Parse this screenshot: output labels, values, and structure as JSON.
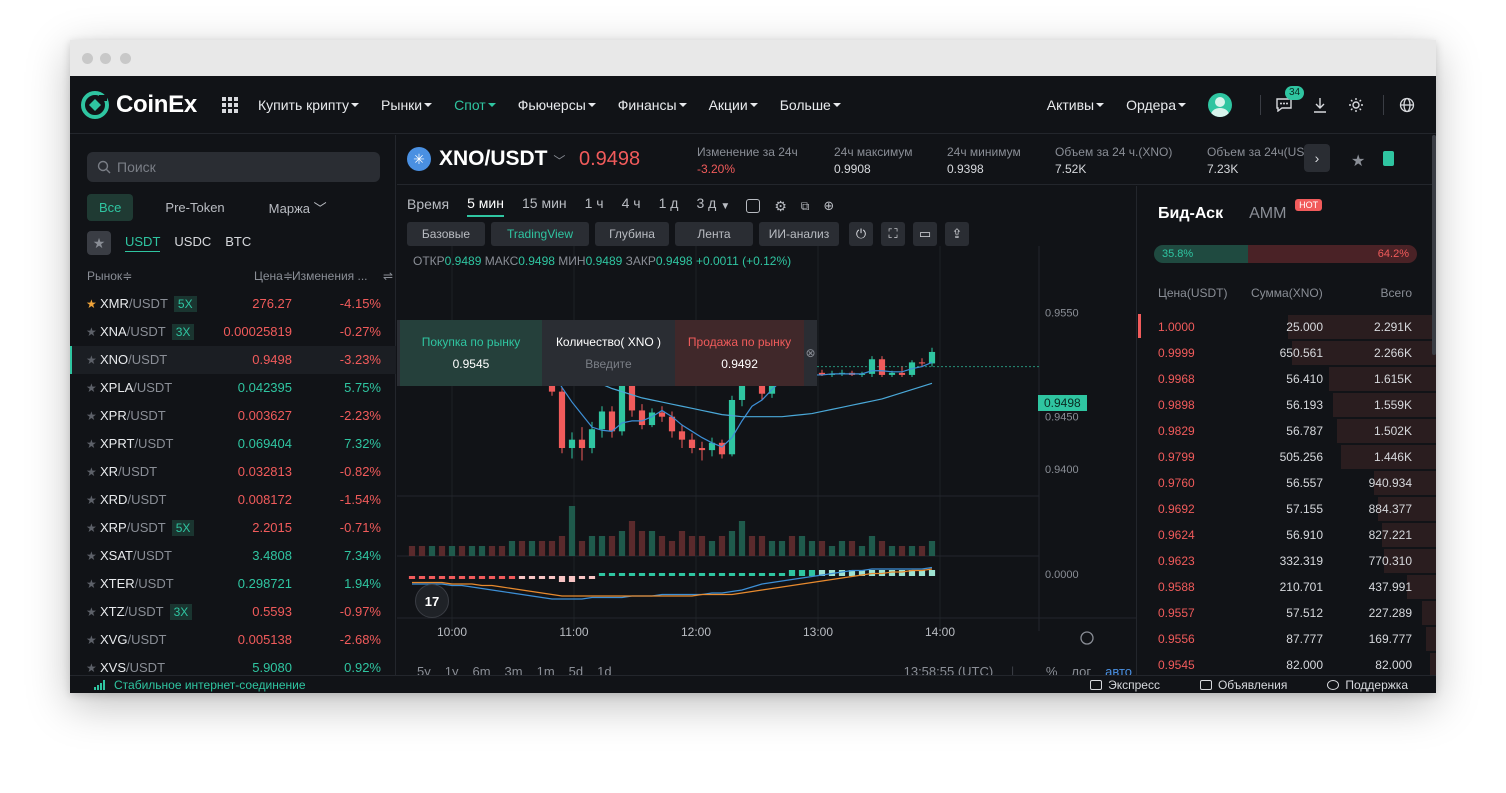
{
  "nav": {
    "logo": "CoinEx",
    "items": [
      {
        "label": "Купить крипту",
        "active": false
      },
      {
        "label": "Рынки",
        "active": false
      },
      {
        "label": "Спот",
        "active": true
      },
      {
        "label": "Фьючерсы",
        "active": false
      },
      {
        "label": "Финансы",
        "active": false
      },
      {
        "label": "Акции",
        "active": false
      },
      {
        "label": "Больше",
        "active": false
      }
    ],
    "right": {
      "assets": "Активы",
      "orders": "Ордера",
      "notifications_count": "34",
      "icons": [
        "chat-icon",
        "download-icon",
        "theme-icon",
        "globe-icon"
      ]
    }
  },
  "sidebar": {
    "search_placeholder": "Поиск",
    "filters": [
      "Все",
      "Pre-Token",
      "Маржа"
    ],
    "active_filter": "Все",
    "quote_tabs": [
      "USDT",
      "USDC",
      "BTC"
    ],
    "active_quote": "USDT",
    "col_market": "Рынок",
    "col_price": "Цена",
    "col_change": "Изменения ...",
    "pairs": [
      {
        "base": "XMR",
        "quote": "/USDT",
        "lev": "5X",
        "price": "276.27",
        "change": "-4.15%",
        "dir": "down",
        "fav": true
      },
      {
        "base": "XNA",
        "quote": "/USDT",
        "lev": "3X",
        "price": "0.00025819",
        "change": "-0.27%",
        "dir": "down",
        "fav": false
      },
      {
        "base": "XNO",
        "quote": "/USDT",
        "lev": "",
        "price": "0.9498",
        "change": "-3.23%",
        "dir": "down",
        "fav": false,
        "selected": true
      },
      {
        "base": "XPLA",
        "quote": "/USDT",
        "lev": "",
        "price": "0.042395",
        "change": "5.75%",
        "dir": "up",
        "fav": false
      },
      {
        "base": "XPR",
        "quote": "/USDT",
        "lev": "",
        "price": "0.003627",
        "change": "-2.23%",
        "dir": "down",
        "fav": false
      },
      {
        "base": "XPRT",
        "quote": "/USDT",
        "lev": "",
        "price": "0.069404",
        "change": "7.32%",
        "dir": "up",
        "fav": false
      },
      {
        "base": "XR",
        "quote": "/USDT",
        "lev": "",
        "price": "0.032813",
        "change": "-0.82%",
        "dir": "down",
        "fav": false
      },
      {
        "base": "XRD",
        "quote": "/USDT",
        "lev": "",
        "price": "0.008172",
        "change": "-1.54%",
        "dir": "down",
        "fav": false
      },
      {
        "base": "XRP",
        "quote": "/USDT",
        "lev": "5X",
        "price": "2.2015",
        "change": "-0.71%",
        "dir": "down",
        "fav": false
      },
      {
        "base": "XSAT",
        "quote": "/USDT",
        "lev": "",
        "price": "3.4808",
        "change": "7.34%",
        "dir": "up",
        "fav": false
      },
      {
        "base": "XTER",
        "quote": "/USDT",
        "lev": "",
        "price": "0.298721",
        "change": "1.94%",
        "dir": "up",
        "fav": false
      },
      {
        "base": "XTZ",
        "quote": "/USDT",
        "lev": "3X",
        "price": "0.5593",
        "change": "-0.97%",
        "dir": "down",
        "fav": false
      },
      {
        "base": "XVG",
        "quote": "/USDT",
        "lev": "",
        "price": "0.005138",
        "change": "-2.68%",
        "dir": "down",
        "fav": false
      },
      {
        "base": "XVS",
        "quote": "/USDT",
        "lev": "",
        "price": "5.9080",
        "change": "0.92%",
        "dir": "up",
        "fav": false
      }
    ]
  },
  "ticker": {
    "symbol": "XNO/USDT",
    "last_price": "0.9498",
    "stats": [
      {
        "label": "Изменение за 24ч",
        "value": "-3.20%",
        "dir": "down"
      },
      {
        "label": "24ч максимум",
        "value": "0.9908",
        "dir": "neutral"
      },
      {
        "label": "24ч минимум",
        "value": "0.9398",
        "dir": "neutral"
      },
      {
        "label": "Объем за 24 ч.(XNO)",
        "value": "7.52K",
        "dir": "neutral"
      },
      {
        "label": "Объем за 24ч(USDT)",
        "value": "7.23K",
        "dir": "neutral"
      }
    ]
  },
  "chart": {
    "timeframe_label": "Время",
    "timeframes": [
      "5 мин",
      "15 мин",
      "1 ч",
      "4 ч",
      "1 д",
      "3 д"
    ],
    "active_timeframe": "5 мин",
    "views": [
      "Базовые",
      "TradingView",
      "Глубина",
      "Лента",
      "ИИ-анализ"
    ],
    "active_view": "TradingView",
    "ohlc": {
      "open_label": "ОТКР",
      "open": "0.9489",
      "high_label": "МАКС",
      "high": "0.9498",
      "low_label": "МИН",
      "low": "0.9489",
      "close_label": "ЗАКР",
      "close": "0.9498",
      "change": "+0.0011 (+0.12%)"
    },
    "quick_trade": {
      "buy_label": "Покупка по рынку",
      "buy_price": "0.9545",
      "qty_label": "Количество( XNO )",
      "qty_placeholder": "Введите",
      "sell_label": "Продажа по рынку",
      "sell_price": "0.9492"
    },
    "price_tag": "0.9498",
    "tv_logo": "17",
    "footer_ranges": [
      "5y",
      "1y",
      "6m",
      "3m",
      "1m",
      "5d",
      "1d"
    ],
    "footer_time": "13:58:55 (UTC)",
    "footer_right": [
      "%",
      "лог",
      "авто"
    ],
    "colors": {
      "up": "#2fc5a1",
      "down": "#f15b5b",
      "ma1": "#3d8fd6",
      "ma2": "#4aa8d8",
      "macd": "#e88a2e"
    }
  },
  "chart_data": {
    "type": "candlestick",
    "symbol": "XNO/USDT",
    "interval": "5 мин",
    "y_ticks": [
      "0.9550",
      "0.9450",
      "0.9400"
    ],
    "indicator_tick": "0.0000",
    "x_ticks": [
      "10:00",
      "11:00",
      "12:00",
      "13:00",
      "14:00"
    ],
    "candles": [
      {
        "o": 0.952,
        "h": 0.9528,
        "l": 0.9505,
        "c": 0.9512
      },
      {
        "o": 0.9512,
        "h": 0.9519,
        "l": 0.9502,
        "c": 0.9507
      },
      {
        "o": 0.9507,
        "h": 0.9523,
        "l": 0.95,
        "c": 0.9516
      },
      {
        "o": 0.9516,
        "h": 0.952,
        "l": 0.949,
        "c": 0.9495
      },
      {
        "o": 0.9495,
        "h": 0.9522,
        "l": 0.949,
        "c": 0.9518
      },
      {
        "o": 0.9518,
        "h": 0.9524,
        "l": 0.9508,
        "c": 0.9512
      },
      {
        "o": 0.9512,
        "h": 0.9518,
        "l": 0.9505,
        "c": 0.9515
      },
      {
        "o": 0.9515,
        "h": 0.953,
        "l": 0.951,
        "c": 0.9526
      },
      {
        "o": 0.9526,
        "h": 0.9532,
        "l": 0.9508,
        "c": 0.9512
      },
      {
        "o": 0.9512,
        "h": 0.9516,
        "l": 0.9505,
        "c": 0.9508
      },
      {
        "o": 0.9508,
        "h": 0.9511,
        "l": 0.9505,
        "c": 0.9508
      },
      {
        "o": 0.9508,
        "h": 0.9512,
        "l": 0.9492,
        "c": 0.9496
      },
      {
        "o": 0.9496,
        "h": 0.9502,
        "l": 0.949,
        "c": 0.95
      },
      {
        "o": 0.95,
        "h": 0.9505,
        "l": 0.9494,
        "c": 0.9496
      },
      {
        "o": 0.9496,
        "h": 0.95,
        "l": 0.947,
        "c": 0.9474
      },
      {
        "o": 0.9474,
        "h": 0.9478,
        "l": 0.9415,
        "c": 0.942
      },
      {
        "o": 0.942,
        "h": 0.9435,
        "l": 0.941,
        "c": 0.9428
      },
      {
        "o": 0.9428,
        "h": 0.944,
        "l": 0.9408,
        "c": 0.942
      },
      {
        "o": 0.942,
        "h": 0.9445,
        "l": 0.9415,
        "c": 0.9438
      },
      {
        "o": 0.9438,
        "h": 0.946,
        "l": 0.943,
        "c": 0.9455
      },
      {
        "o": 0.9455,
        "h": 0.946,
        "l": 0.943,
        "c": 0.9436
      },
      {
        "o": 0.9436,
        "h": 0.9488,
        "l": 0.9432,
        "c": 0.9484
      },
      {
        "o": 0.9484,
        "h": 0.949,
        "l": 0.945,
        "c": 0.9456
      },
      {
        "o": 0.9456,
        "h": 0.9462,
        "l": 0.9438,
        "c": 0.9442
      },
      {
        "o": 0.9442,
        "h": 0.9458,
        "l": 0.944,
        "c": 0.9454
      },
      {
        "o": 0.9454,
        "h": 0.946,
        "l": 0.9445,
        "c": 0.945
      },
      {
        "o": 0.945,
        "h": 0.9455,
        "l": 0.943,
        "c": 0.9436
      },
      {
        "o": 0.9436,
        "h": 0.9442,
        "l": 0.942,
        "c": 0.9428
      },
      {
        "o": 0.9428,
        "h": 0.9434,
        "l": 0.9415,
        "c": 0.942
      },
      {
        "o": 0.942,
        "h": 0.9426,
        "l": 0.9408,
        "c": 0.9418
      },
      {
        "o": 0.9418,
        "h": 0.943,
        "l": 0.9412,
        "c": 0.9425
      },
      {
        "o": 0.9425,
        "h": 0.9428,
        "l": 0.941,
        "c": 0.9414
      },
      {
        "o": 0.9414,
        "h": 0.947,
        "l": 0.9412,
        "c": 0.9466
      },
      {
        "o": 0.9466,
        "h": 0.95,
        "l": 0.946,
        "c": 0.9496
      },
      {
        "o": 0.9496,
        "h": 0.9504,
        "l": 0.9482,
        "c": 0.9488
      },
      {
        "o": 0.9488,
        "h": 0.9492,
        "l": 0.9466,
        "c": 0.9472
      },
      {
        "o": 0.9472,
        "h": 0.9494,
        "l": 0.9468,
        "c": 0.949
      },
      {
        "o": 0.949,
        "h": 0.9502,
        "l": 0.9486,
        "c": 0.9498
      },
      {
        "o": 0.9498,
        "h": 0.95,
        "l": 0.9488,
        "c": 0.949
      },
      {
        "o": 0.949,
        "h": 0.9493,
        "l": 0.9487,
        "c": 0.9491
      },
      {
        "o": 0.9491,
        "h": 0.9494,
        "l": 0.9488,
        "c": 0.9492
      },
      {
        "o": 0.9492,
        "h": 0.9495,
        "l": 0.9489,
        "c": 0.949
      },
      {
        "o": 0.949,
        "h": 0.9494,
        "l": 0.9488,
        "c": 0.9491
      },
      {
        "o": 0.9491,
        "h": 0.9495,
        "l": 0.9489,
        "c": 0.9492
      },
      {
        "o": 0.9492,
        "h": 0.9494,
        "l": 0.9489,
        "c": 0.949
      },
      {
        "o": 0.949,
        "h": 0.9493,
        "l": 0.9488,
        "c": 0.9491
      },
      {
        "o": 0.9491,
        "h": 0.9508,
        "l": 0.9488,
        "c": 0.9505
      },
      {
        "o": 0.9505,
        "h": 0.9508,
        "l": 0.9488,
        "c": 0.949
      },
      {
        "o": 0.949,
        "h": 0.9494,
        "l": 0.9488,
        "c": 0.9492
      },
      {
        "o": 0.9492,
        "h": 0.9498,
        "l": 0.9488,
        "c": 0.949
      },
      {
        "o": 0.949,
        "h": 0.9504,
        "l": 0.9488,
        "c": 0.9502
      },
      {
        "o": 0.9502,
        "h": 0.9506,
        "l": 0.9498,
        "c": 0.9501
      },
      {
        "o": 0.9501,
        "h": 0.9516,
        "l": 0.9498,
        "c": 0.9512
      }
    ],
    "volumes": [
      2,
      2,
      2,
      2,
      2,
      2,
      2,
      2,
      2,
      2,
      3,
      3,
      3,
      3,
      3,
      4,
      10,
      3,
      4,
      4,
      4,
      5,
      7,
      5,
      5,
      4,
      3,
      5,
      4,
      4,
      3,
      4,
      5,
      7,
      4,
      4,
      3,
      3,
      4,
      4,
      3,
      3,
      2,
      3,
      3,
      2,
      4,
      3,
      2,
      2,
      2,
      2,
      3,
      3,
      4
    ],
    "ma_short": [
      0.9512,
      0.9511,
      0.9512,
      0.9508,
      0.951,
      0.9511,
      0.9511,
      0.9514,
      0.9514,
      0.9512,
      0.9511,
      0.9507,
      0.9502,
      0.95,
      0.9494,
      0.9478,
      0.9464,
      0.9452,
      0.944,
      0.9437,
      0.9436,
      0.9444,
      0.9446,
      0.9446,
      0.945,
      0.9456,
      0.945,
      0.9442,
      0.9436,
      0.943,
      0.9425,
      0.9421,
      0.943,
      0.9446,
      0.946,
      0.9466,
      0.9476,
      0.9485,
      0.9488,
      0.9489,
      0.949,
      0.949,
      0.9491,
      0.9491,
      0.9491,
      0.9491,
      0.9494,
      0.9494,
      0.9493,
      0.9493,
      0.9496,
      0.9498,
      0.9502
    ],
    "ma_long": [
      0.9524,
      0.9522,
      0.9521,
      0.9519,
      0.9518,
      0.9517,
      0.9516,
      0.9516,
      0.9515,
      0.9514,
      0.9513,
      0.9511,
      0.9509,
      0.9507,
      0.9505,
      0.95,
      0.9495,
      0.949,
      0.9485,
      0.9481,
      0.9477,
      0.9474,
      0.9471,
      0.9468,
      0.9466,
      0.9464,
      0.9462,
      0.946,
      0.9458,
      0.9456,
      0.9454,
      0.9452,
      0.9451,
      0.945,
      0.945,
      0.945,
      0.945,
      0.945,
      0.9451,
      0.9452,
      0.9453,
      0.9455,
      0.9457,
      0.9459,
      0.9461,
      0.9463,
      0.9465,
      0.9467,
      0.947,
      0.9473,
      0.9476,
      0.9479,
      0.9482
    ],
    "macd_hist": [
      -1,
      -1,
      -1,
      -1,
      -1,
      -1,
      -1,
      -1,
      -1,
      -1,
      -1,
      -1,
      -1,
      -1,
      -1,
      -2,
      -2,
      -1,
      -1,
      1,
      1,
      1,
      1,
      1,
      1,
      1,
      1,
      1,
      1,
      1,
      1,
      1,
      1,
      1,
      1,
      1,
      1,
      1,
      2,
      2,
      2,
      2,
      2,
      2,
      2,
      2,
      2,
      2,
      2,
      2,
      2,
      2,
      2,
      2,
      2
    ],
    "macd_line": [
      0,
      0,
      0,
      0,
      -1,
      -1,
      -2,
      -3,
      -4,
      -5,
      -6,
      -7,
      -8,
      -9,
      -10,
      -10,
      -10,
      -10,
      -9,
      -9,
      -9,
      -9,
      -8,
      -8,
      -8,
      -7,
      -7,
      -7,
      -7,
      -7,
      -6,
      -6,
      -5,
      -4,
      -2,
      0,
      1,
      2,
      3,
      4,
      5,
      6,
      7,
      8,
      9,
      9,
      10,
      10,
      10,
      10,
      10,
      10,
      11,
      11,
      12
    ],
    "signal_line": [
      1,
      1,
      1,
      1,
      0,
      0,
      0,
      -1,
      -1,
      -2,
      -3,
      -4,
      -5,
      -6,
      -7,
      -8,
      -8,
      -8,
      -8,
      -8,
      -8,
      -8,
      -8,
      -8,
      -8,
      -8,
      -8,
      -8,
      -8,
      -7,
      -7,
      -7,
      -7,
      -6,
      -5,
      -4,
      -3,
      -2,
      -1,
      0,
      1,
      2,
      3,
      4,
      5,
      6,
      7,
      7,
      8,
      8,
      9,
      9,
      10,
      10,
      11
    ]
  },
  "orderbook": {
    "tabs": [
      "Бид-Аск",
      "AMM"
    ],
    "hot_label": "HOT",
    "buy_ratio": "35.8%",
    "sell_ratio": "64.2%",
    "col_price": "Цена(USDT)",
    "col_amount": "Сумма(XNO)",
    "col_total": "Всего",
    "asks": [
      {
        "price": "1.0000",
        "amount": "25.000",
        "total": "2.291K",
        "depth": 0.72
      },
      {
        "price": "0.9999",
        "amount": "650.561",
        "total": "2.266K",
        "depth": 0.7
      },
      {
        "price": "0.9968",
        "amount": "56.410",
        "total": "1.615K",
        "depth": 0.52
      },
      {
        "price": "0.9898",
        "amount": "56.193",
        "total": "1.559K",
        "depth": 0.5
      },
      {
        "price": "0.9829",
        "amount": "56.787",
        "total": "1.502K",
        "depth": 0.48
      },
      {
        "price": "0.9799",
        "amount": "505.256",
        "total": "1.446K",
        "depth": 0.46
      },
      {
        "price": "0.9760",
        "amount": "56.557",
        "total": "940.934",
        "depth": 0.3
      },
      {
        "price": "0.9692",
        "amount": "57.155",
        "total": "884.377",
        "depth": 0.28
      },
      {
        "price": "0.9624",
        "amount": "56.910",
        "total": "827.221",
        "depth": 0.26
      },
      {
        "price": "0.9623",
        "amount": "332.319",
        "total": "770.310",
        "depth": 0.25
      },
      {
        "price": "0.9588",
        "amount": "210.701",
        "total": "437.991",
        "depth": 0.14
      },
      {
        "price": "0.9557",
        "amount": "57.512",
        "total": "227.289",
        "depth": 0.07
      },
      {
        "price": "0.9556",
        "amount": "87.777",
        "total": "169.777",
        "depth": 0.05
      },
      {
        "price": "0.9545",
        "amount": "82.000",
        "total": "82.000",
        "depth": 0.03
      }
    ]
  },
  "statusbar": {
    "connection": "Стабильное интернет-соединение",
    "items": [
      "Экспресс",
      "Объявления",
      "Поддержка"
    ]
  }
}
